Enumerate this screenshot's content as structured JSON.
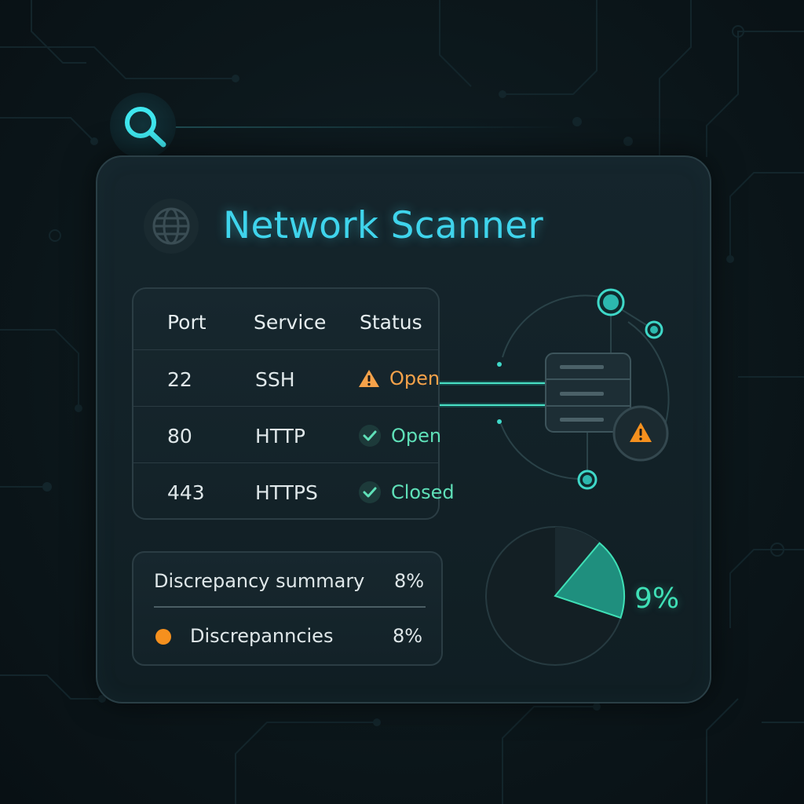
{
  "app": {
    "title": "Network Scanner"
  },
  "icons": {
    "search": "search-icon",
    "globe": "globe-icon",
    "warning": "warning-icon",
    "check": "check-icon",
    "server": "server-icon"
  },
  "colors": {
    "accent": "#3fd4ec",
    "ok": "#5fe0b8",
    "warning": "#f5a24a",
    "dot": "#f5901e"
  },
  "ports_table": {
    "headers": [
      "Port",
      "Service",
      "Status"
    ],
    "rows": [
      {
        "port": "22",
        "service": "SSH",
        "status": "Open",
        "status_kind": "warning"
      },
      {
        "port": "80",
        "service": "HTTP",
        "status": "Open",
        "status_kind": "ok"
      },
      {
        "port": "443",
        "service": "HTTPS",
        "status": "Closed",
        "status_kind": "ok"
      }
    ]
  },
  "summary": {
    "label": "Discrepancy summary",
    "value": "8%",
    "item_label": "Discrepanncies",
    "item_value": "8%"
  },
  "pie": {
    "value_label": "9%",
    "highlight_fraction": 0.19
  }
}
